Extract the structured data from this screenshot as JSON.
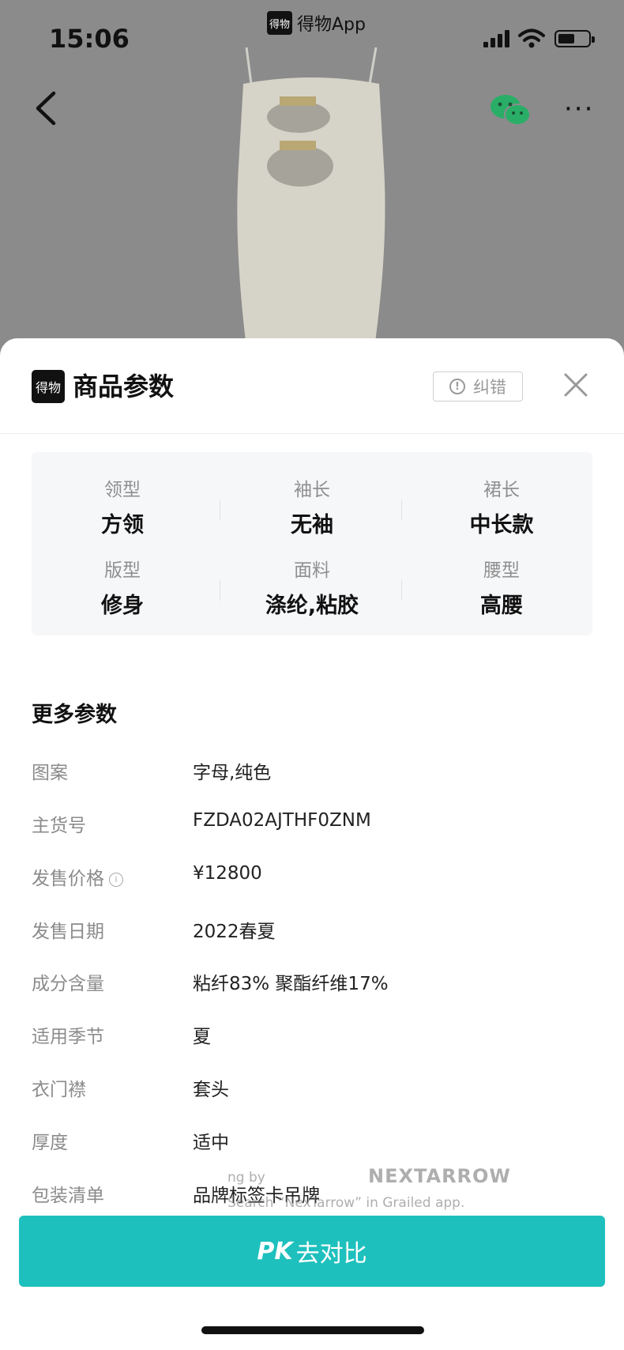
{
  "status_bar": {
    "time": "15:06",
    "app_name": "得物App",
    "app_logo_text": "得物"
  },
  "nav": {
    "back_icon": "chevron-left-icon",
    "share_icon": "wechat-icon",
    "more_label": "···"
  },
  "sheet": {
    "logo_text": "得物",
    "title": "商品参数",
    "report_label": "纠错",
    "close_icon": "close-icon"
  },
  "key_params": [
    {
      "label": "领型",
      "value": "方领"
    },
    {
      "label": "袖长",
      "value": "无袖"
    },
    {
      "label": "裙长",
      "value": "中长款"
    },
    {
      "label": "版型",
      "value": "修身"
    },
    {
      "label": "面料",
      "value": "涤纶,粘胶"
    },
    {
      "label": "腰型",
      "value": "高腰"
    }
  ],
  "more_params": {
    "title": "更多参数",
    "rows": [
      {
        "key": "图案",
        "value": "字母,纯色"
      },
      {
        "key": "主货号",
        "value": "FZDA02AJTHF0ZNM"
      },
      {
        "key": "发售价格",
        "value": "¥12800"
      },
      {
        "key": "发售日期",
        "value": "2022春夏"
      },
      {
        "key": "成分含量",
        "value": "粘纤83% 聚酯纤维17%"
      },
      {
        "key": "适用季节",
        "value": "夏"
      },
      {
        "key": "衣门襟",
        "value": "套头"
      },
      {
        "key": "厚度",
        "value": "适中"
      },
      {
        "key": "包装清单",
        "value": "品牌标签卡吊牌"
      }
    ]
  },
  "watermark": {
    "line1": "ng by",
    "brand": "NEXTARROW",
    "line2": "Search “NexTarrow” in Grailed app."
  },
  "pk_button": {
    "pk": "PK",
    "label": "去对比"
  },
  "colors": {
    "accent": "#1ec0bd"
  }
}
